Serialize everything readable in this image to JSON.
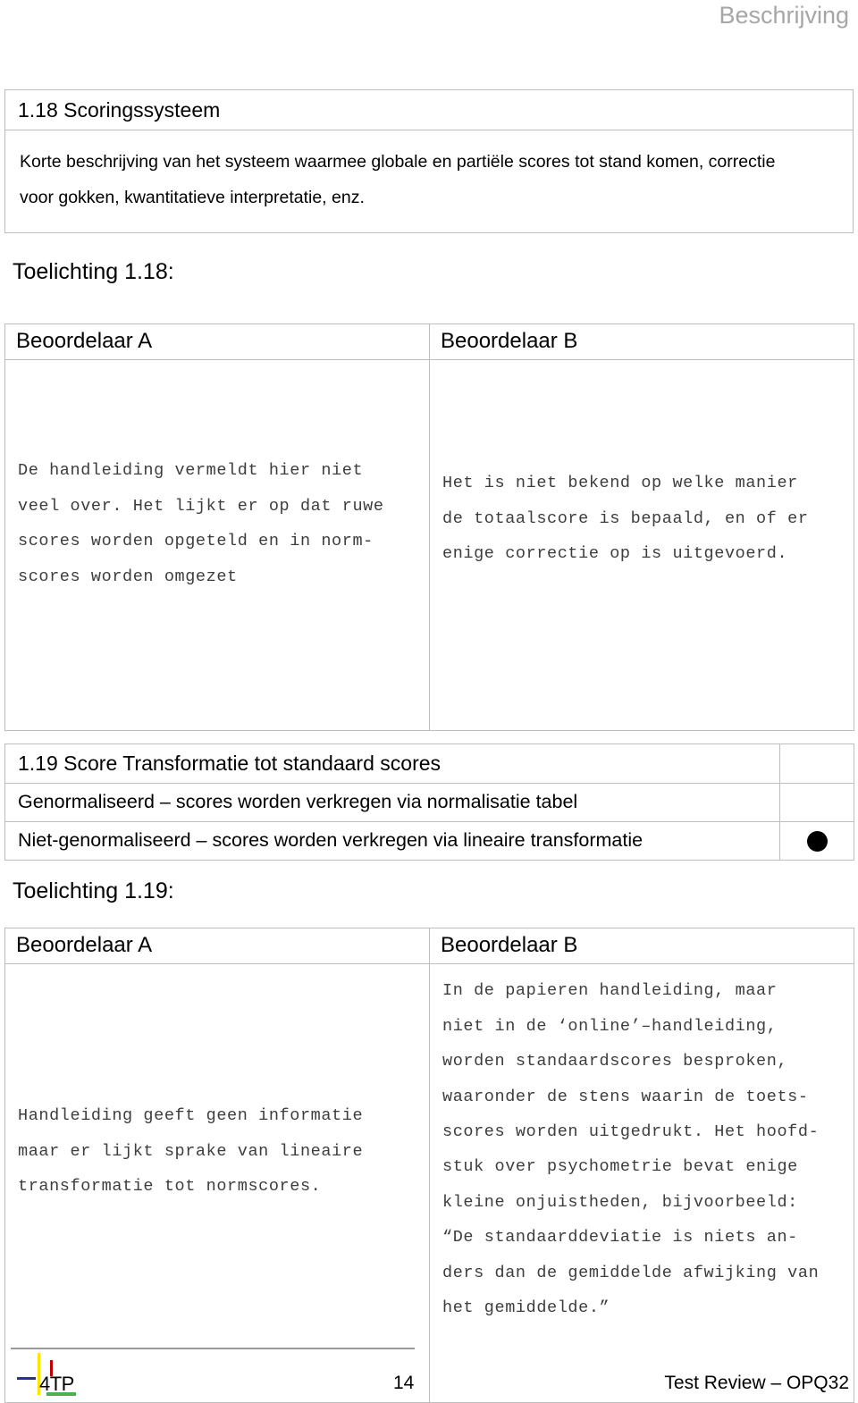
{
  "header": {
    "running_title": "Beschrijving",
    "running_title_color": "#a6a6a6"
  },
  "sections": [
    {
      "id": "1.18",
      "title": "1.18 Scoringssysteem",
      "body_lines": [
        "Korte beschrijving van het systeem waarmee globale en partiële scores tot stand komen, correctie",
        "voor gokken, kwantitatieve interpretatie, enz."
      ],
      "toelichting_label": "Toelichting 1.18:",
      "rater_table": {
        "col_a_header": "Beoordelaar A",
        "col_b_header": "Beoordelaar B",
        "col_a_text": "De handleiding vermeldt hier niet\nveel over. Het lijkt er op dat ruwe\nscores worden opgeteld en in norm-\nscores worden omgezet",
        "col_b_text": "Het is niet bekend op welke manier\nde totaalscore is bepaald, en of er\nenige correctie op is uitgevoerd."
      }
    },
    {
      "id": "1.19",
      "title": "1.19 Score Transformatie tot standaard scores",
      "options": [
        {
          "label": "Genormaliseerd – scores worden verkregen via normalisatie tabel",
          "selected": false
        },
        {
          "label": "Niet-genormaliseerd – scores worden verkregen via lineaire transformatie",
          "selected": true
        }
      ],
      "toelichting_label": "Toelichting 1.19:",
      "rater_table": {
        "col_a_header": "Beoordelaar A",
        "col_b_header": "Beoordelaar B",
        "col_a_text": "Handleiding geeft geen informatie\nmaar er lijkt sprake van lineaire\ntransformatie tot normscores.",
        "col_b_text": "In de papieren handleiding, maar\nniet in de ‘online’–handleiding,\nworden standaardscores besproken,\nwaaronder de stens waarin de toets-\nscores worden uitgedrukt. Het hoofd-\nstuk over psychometrie bevat enige\nkleine onjuistheden, bijvoorbeeld:\n“De standaarddeviatie is niets an-\nders dan de gemiddelde afwijking van\nhet gemiddelde.”"
      }
    }
  ],
  "footer": {
    "logo_text": "4TP",
    "logo_colors": {
      "yellow": "#ffe400",
      "red": "#c00000",
      "blue": "#26348b",
      "green": "#4caf50"
    },
    "page_number": "14",
    "right_text": "Test Review – OPQ32"
  }
}
